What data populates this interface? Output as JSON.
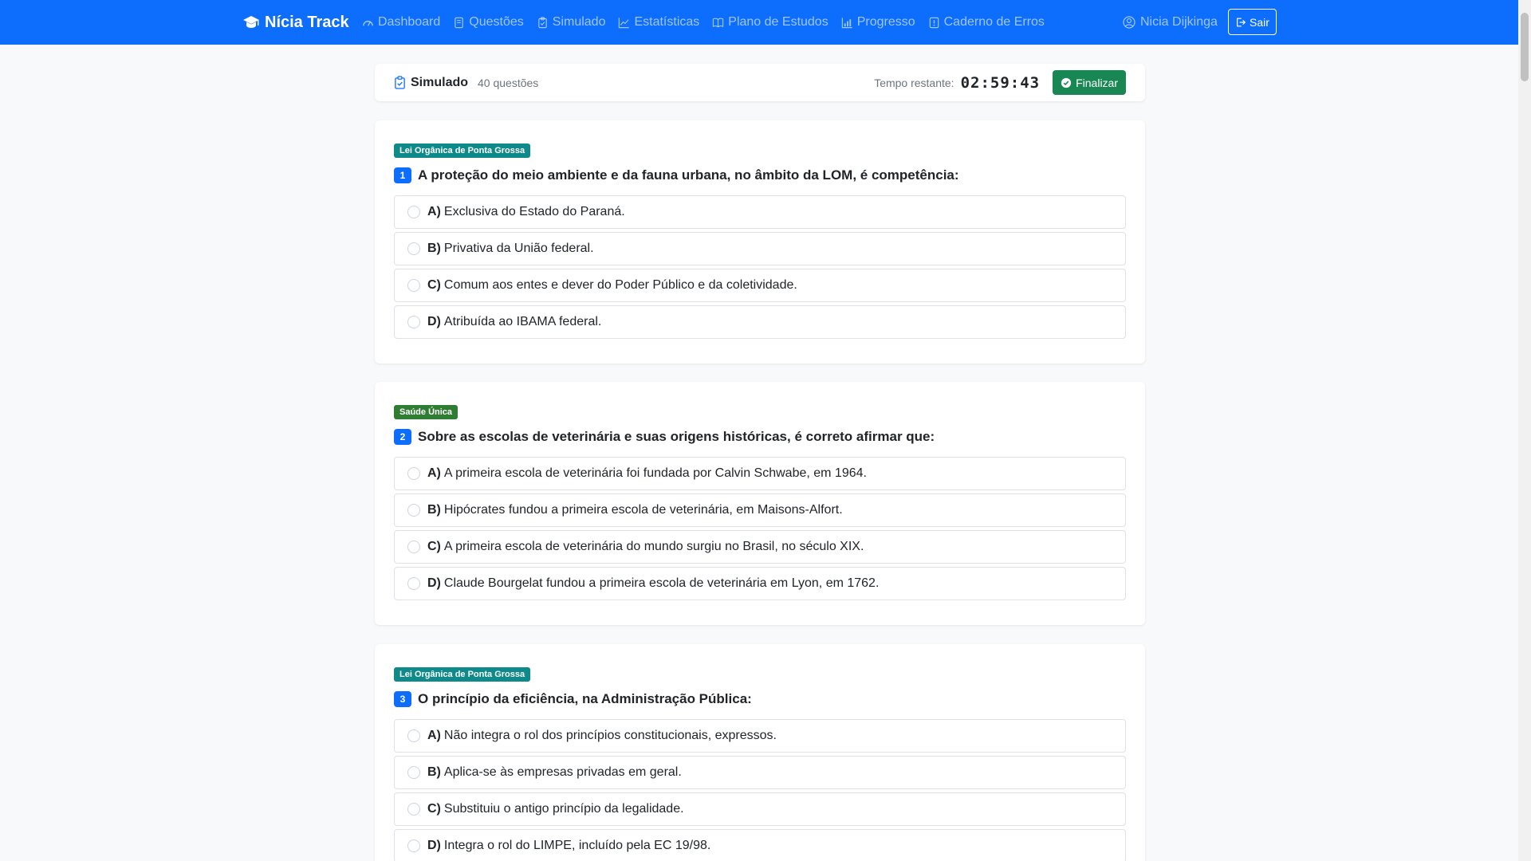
{
  "navbar": {
    "brand": "Nícia Track",
    "links": [
      {
        "label": "Dashboard",
        "icon": "dashboard-icon"
      },
      {
        "label": "Questões",
        "icon": "questions-icon"
      },
      {
        "label": "Simulado",
        "icon": "clipboard-icon"
      },
      {
        "label": "Estatísticas",
        "icon": "chart-line-icon"
      },
      {
        "label": "Plano de Estudos",
        "icon": "book-icon"
      },
      {
        "label": "Progresso",
        "icon": "bar-chart-icon"
      },
      {
        "label": "Caderno de Erros",
        "icon": "error-notebook-icon"
      }
    ],
    "user": "Nicia Dijkinga",
    "logout_label": "Sair",
    "color": "#0d6efd"
  },
  "header": {
    "title": "Simulado",
    "count": "40 questões",
    "timer_label": "Tempo restante:",
    "timer": "02:59:43",
    "finish_label": "Finalizar"
  },
  "questions": [
    {
      "number": "1",
      "topic": "Lei Orgânica de Ponta Grossa",
      "topic_color": "#0f8a8a",
      "text": "A proteção do meio ambiente e da fauna urbana, no âmbito da LOM, é competência:",
      "options": [
        {
          "letter": "A)",
          "text": "Exclusiva do Estado do Paraná."
        },
        {
          "letter": "B)",
          "text": "Privativa da União federal."
        },
        {
          "letter": "C)",
          "text": "Comum aos entes e dever do Poder Público e da coletividade."
        },
        {
          "letter": "D)",
          "text": "Atribuída ao IBAMA federal."
        }
      ]
    },
    {
      "number": "2",
      "topic": "Saúde Única",
      "topic_color": "#2e7d32",
      "text": "Sobre as escolas de veterinária e suas origens históricas, é correto afirmar que:",
      "options": [
        {
          "letter": "A)",
          "text": "A primeira escola de veterinária foi fundada por Calvin Schwabe, em 1964."
        },
        {
          "letter": "B)",
          "text": "Hipócrates fundou a primeira escola de veterinária, em Maisons-Alfort."
        },
        {
          "letter": "C)",
          "text": "A primeira escola de veterinária do mundo surgiu no Brasil, no século XIX."
        },
        {
          "letter": "D)",
          "text": "Claude Bourgelat fundou a primeira escola de veterinária em Lyon, em 1762."
        }
      ]
    },
    {
      "number": "3",
      "topic": "Lei Orgânica de Ponta Grossa",
      "topic_color": "#0f8a8a",
      "text": "O princípio da eficiência, na Administração Pública:",
      "options": [
        {
          "letter": "A)",
          "text": "Não integra o rol dos princípios constitucionais, expressos."
        },
        {
          "letter": "B)",
          "text": "Aplica-se às empresas privadas em geral."
        },
        {
          "letter": "C)",
          "text": "Substituiu o antigo princípio da legalidade."
        },
        {
          "letter": "D)",
          "text": "Integra o rol do LIMPE, incluído pela EC 19/98."
        }
      ]
    }
  ]
}
